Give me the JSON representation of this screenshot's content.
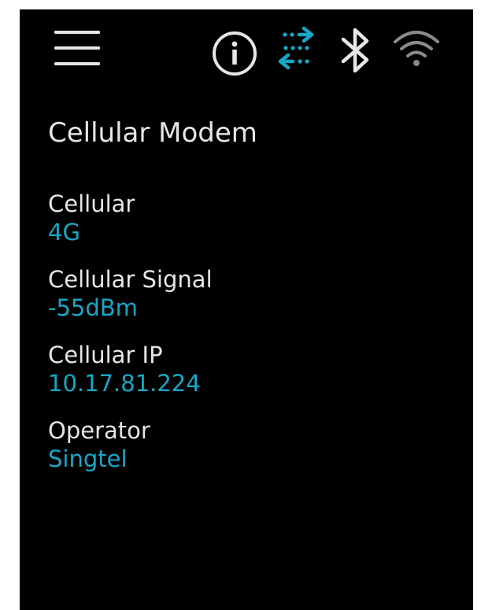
{
  "colors": {
    "background": "#000000",
    "text": "#e6e6e6",
    "accent": "#17a7c6",
    "dim": "#8a8a8a"
  },
  "header": {
    "icons": [
      "hamburger-menu-icon",
      "info-icon",
      "data-transfer-icon",
      "bluetooth-icon",
      "wifi-icon"
    ]
  },
  "page": {
    "title": "Cellular Modem"
  },
  "details": [
    {
      "label": "Cellular",
      "value": "4G"
    },
    {
      "label": "Cellular Signal",
      "value": "-55dBm"
    },
    {
      "label": "Cellular IP",
      "value": "10.17.81.224"
    },
    {
      "label": "Operator",
      "value": "Singtel"
    }
  ]
}
